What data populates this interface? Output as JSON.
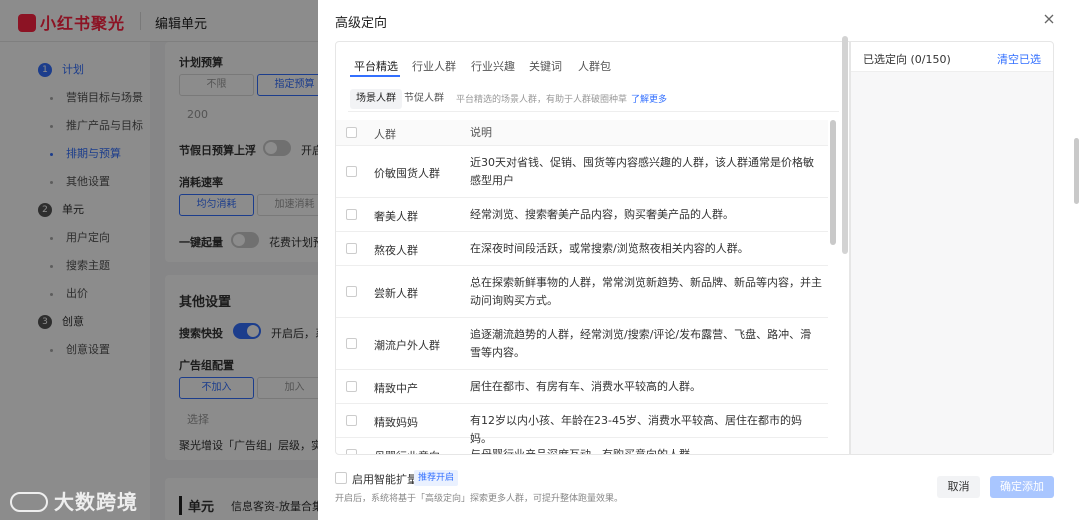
{
  "background": {
    "logo": "小红书聚光",
    "page_title": "编辑单元",
    "steps": [
      {
        "num": "1",
        "label": "计划",
        "subs": [
          "营销目标与场景",
          "推广产品与目标",
          "排期与预算",
          "其他设置"
        ]
      },
      {
        "num": "2",
        "label": "单元",
        "subs": [
          "用户定向",
          "搜索主题",
          "出价"
        ]
      },
      {
        "num": "3",
        "label": "创意",
        "subs": [
          "创意设置"
        ]
      }
    ],
    "form": {
      "plan_budget": "计划预算",
      "unlimited": "不限",
      "specified_budget": "指定预算",
      "amount": "200",
      "holiday_budget": "节假日预算上浮",
      "holiday_toggle_label": "开启",
      "consume_speed": "消耗速率",
      "even_consume": "均匀消耗",
      "accelerated_consume": "加速消耗",
      "one_click_boost": "一键起量",
      "boost_hint": "花费计划预",
      "other_settings": "其他设置",
      "search_express": "搜索快投",
      "search_express_hint": "开启后，系",
      "ad_group_config": "广告组配置",
      "not_join": "不加入",
      "join": "加入",
      "select": "选择",
      "ad_group_hint": "聚光增设「广告组」层级，实现",
      "unit": "单元",
      "unit_hint": "信息客资-放量合集"
    },
    "watermark": "大数跨境"
  },
  "drawer": {
    "title": "高级定向",
    "tabs": [
      "平台精选",
      "行业人群",
      "行业兴趣",
      "关键词",
      "人群包"
    ],
    "active_tab": 0,
    "subtabs": [
      "场景人群",
      "节促人群"
    ],
    "subtab_hint": "平台精选的场景人群，有助于人群破圈种草",
    "learn_more": "了解更多",
    "table": {
      "headers": [
        "人群",
        "说明"
      ],
      "rows": [
        {
          "name": "价敏囤货人群",
          "desc": "近30天对省钱、促销、囤货等内容感兴趣的人群，该人群通常是价格敏感型用户"
        },
        {
          "name": "奢美人群",
          "desc": "经常浏览、搜索奢美产品内容，购买奢美产品的人群。"
        },
        {
          "name": "熬夜人群",
          "desc": "在深夜时间段活跃，或常搜索/浏览熬夜相关内容的人群。"
        },
        {
          "name": "尝新人群",
          "desc": "总在探索新鲜事物的人群，常常浏览新趋势、新品牌、新品等内容，并主动问询购买方式。"
        },
        {
          "name": "潮流户外人群",
          "desc": "追逐潮流趋势的人群，经常浏览/搜索/评论/发布露营、飞盘、路冲、滑雪等内容。"
        },
        {
          "name": "精致中产",
          "desc": "居住在都市、有房有车、消费水平较高的人群。"
        },
        {
          "name": "精致妈妈",
          "desc": "有12岁以内小孩、年龄在23-45岁、消费水平较高、居住在都市的妈妈。"
        },
        {
          "name": "母婴行业意向",
          "desc": "与母婴行业产品深度互动，有购买意向的人群"
        }
      ]
    },
    "selected_title": "已选定向 (0/150)",
    "clear_all": "清空已选",
    "smart_expand": "启用智能扩量",
    "recommend_badge": "推荐开启",
    "smart_hint": "开启后，系统将基于「高级定向」探索更多人群，可提升整体跑量效果。",
    "cancel": "取消",
    "confirm": "确定添加"
  }
}
